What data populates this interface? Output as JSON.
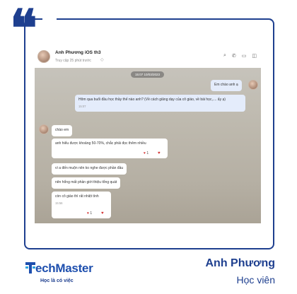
{
  "chat": {
    "contact_name": "Anh Phương iOS th3",
    "contact_status": "Truy cập 25 phút trước",
    "timestamp_pill": "15:07 10/03/2023",
    "messages": {
      "m1": {
        "text": "Em chào anh ạ"
      },
      "m2": {
        "text": "Hôm qua buổi đầu học thầy thế nào anh? (Về cách giảng dạy của cô giáo, về bài học,.... ấy ạ)",
        "time": "15:07"
      },
      "m3": {
        "text": "chào em"
      },
      "m4": {
        "text": "anh hiểu được khoảng 50-70%, chắc phải đọc thêm nhiều",
        "reactions": "1"
      },
      "m5": {
        "text": "vì a đến muộn nên ko nghe được phần đầu"
      },
      "m6": {
        "text": "nên hổng mất phần giới thiệu tổng quát"
      },
      "m7": {
        "text": "còn cô giáo thì rất nhiệt tình",
        "time": "15:56",
        "reactions": "1"
      }
    }
  },
  "brand": {
    "logo_text": "echMaster",
    "tagline": "Học là có việc"
  },
  "person": {
    "name": "Anh Phương",
    "role": "Học viên"
  },
  "colors": {
    "brand_blue": "#1e3f8f",
    "logo_blue": "#1e4fae",
    "logo_accent": "#2fa6e0",
    "bubble_self": "#e4ecfb",
    "reaction_red": "#d32f2f"
  }
}
